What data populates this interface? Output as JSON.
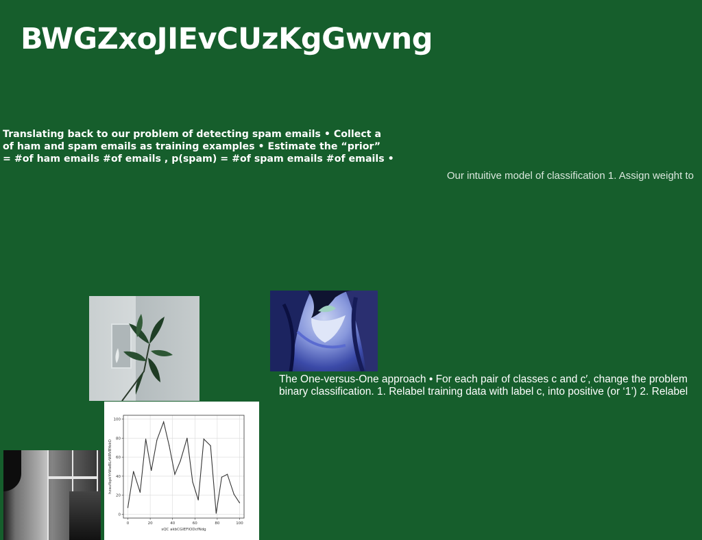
{
  "page": {
    "title": "BWGZxoJIEvCUzKgGwvng",
    "background_color": "#165e2c"
  },
  "text_blocks": {
    "spam_lines": [
      "Translating back to our problem of detecting spam emails • Collect a",
      "of ham and spam emails as training examples • Estimate the “prior”",
      "= #of ham emails #of emails , p(spam) = #of spam emails #of emails •"
    ],
    "intuitive_model": "Our intuitive model of classification 1. Assign weight to",
    "one_vs_one_lines": [
      "The One-versus-One approach • For each pair of classes c and c′, change the problem",
      "binary classification. 1. Relabel training data with label c, into positive (or ‘1’) 2. Relabel"
    ]
  },
  "images": {
    "plant": "plant-photo",
    "hair": "blue-hair-photo",
    "window": "window-photo"
  },
  "chart_data": {
    "type": "line",
    "title": "",
    "xlabel": "sQC akbCGlEFIODcfNdg",
    "ylabel": "hzaufbpkYrWwBLrWRVBYokO",
    "xlim": [
      -4,
      104
    ],
    "ylim": [
      -4,
      104
    ],
    "xticks": [
      0,
      20,
      40,
      60,
      80,
      100
    ],
    "yticks": [
      0,
      20,
      40,
      60,
      80,
      100
    ],
    "grid": true,
    "series": [
      {
        "color": "#333333",
        "x": [
          0,
          5,
          11,
          16,
          21,
          26,
          32,
          37,
          42,
          47,
          53,
          58,
          63,
          68,
          74,
          79,
          84,
          89,
          95,
          100
        ],
        "y": [
          7,
          45,
          23,
          79,
          46,
          78,
          97,
          72,
          42,
          56,
          80,
          34,
          15,
          79,
          72,
          1,
          39,
          42,
          21,
          12
        ]
      }
    ]
  }
}
